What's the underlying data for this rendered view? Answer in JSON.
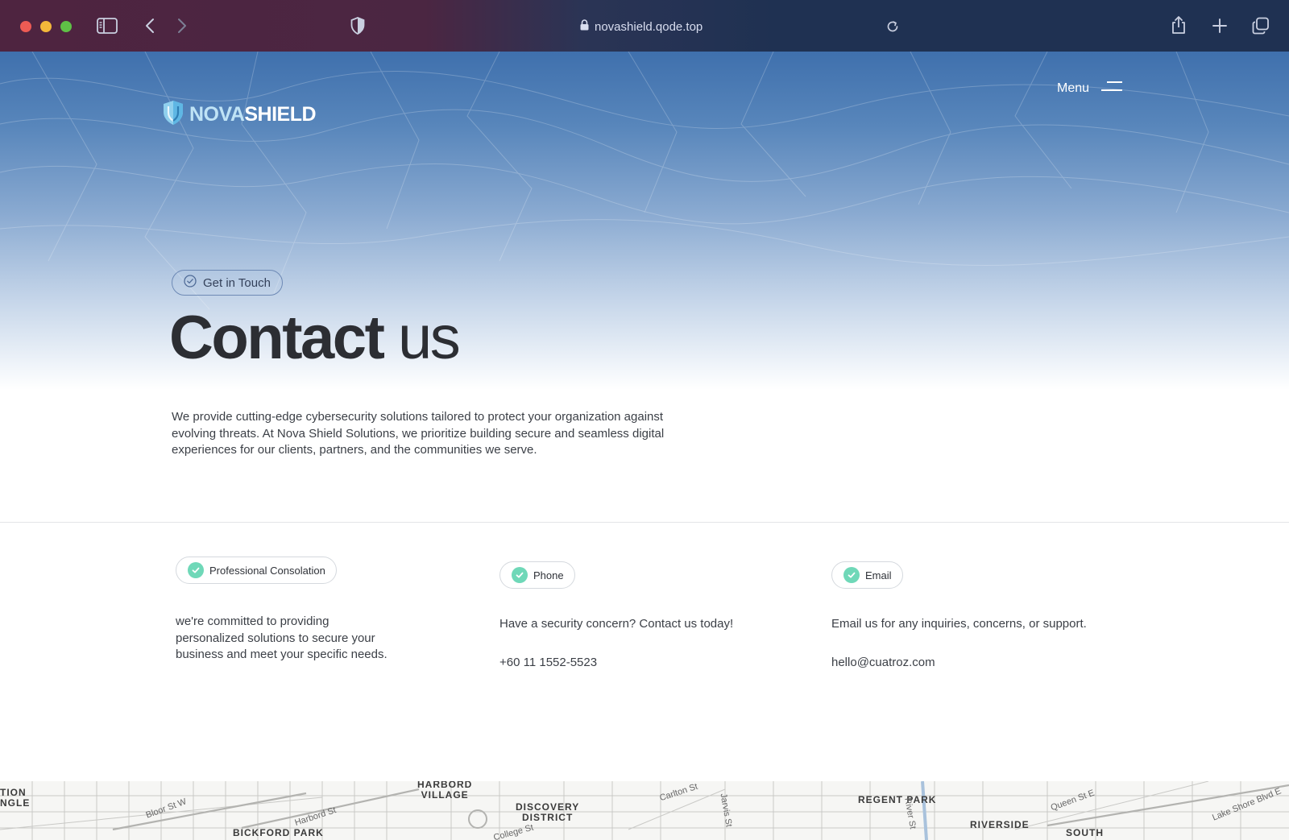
{
  "browser": {
    "url": "novashield.qode.top"
  },
  "header": {
    "logo_part1": "NOVA",
    "logo_part2": "SHIELD",
    "menu_label": "Menu"
  },
  "hero": {
    "badge": "Get in Touch",
    "title_bold": "Contact",
    "title_light": " us",
    "description": "We provide cutting-edge cybersecurity solutions tailored to protect your organization against evolving threats. At Nova Shield Solutions, we prioritize building secure and seamless digital experiences for our clients, partners, and the communities we serve."
  },
  "contact": {
    "consultation": {
      "label": "Professional Consolation",
      "text": "we're committed to providing personalized solutions to secure your business and meet your specific needs."
    },
    "phone": {
      "label": "Phone",
      "text": "Have a security concern? Contact us today!",
      "value": "+60 11 1552-5523"
    },
    "email": {
      "label": "Email",
      "text": "Email us for any inquiries, concerns, or support.",
      "value": "hello@cuatroz.com"
    }
  },
  "map": {
    "labels": {
      "triangle": "TION\nNGLE",
      "harbord_village": "HARBORD\nVILLAGE",
      "discovery": "DISCOVERY\nDISTRICT",
      "regent_park": "REGENT PARK",
      "bickford_park": "BICKFORD PARK",
      "riverside": "RIVERSIDE",
      "south": "SOUTH"
    },
    "streets": {
      "bloor": "Bloor St W",
      "harbord": "Harbord St",
      "carlton": "Carlton St",
      "jarvis": "Jarvis St",
      "queen": "Queen St E",
      "lakeshore": "Lake Shore Blvd E",
      "college": "College St",
      "river": "River St"
    }
  },
  "colors": {
    "accent_check": "#6fd8b8",
    "hero_top": "#3f70ad",
    "title": "#2c2e33"
  }
}
